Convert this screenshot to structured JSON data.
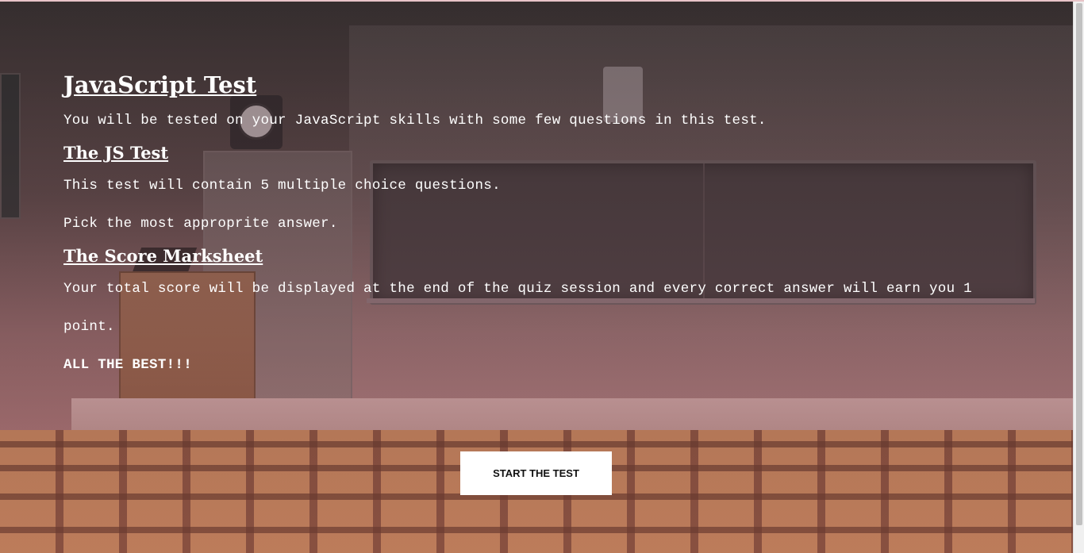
{
  "main": {
    "title": "JavaScript Test",
    "intro": "You will be tested on your JavaScript skills with some few questions in this test.",
    "sections": [
      {
        "heading": "The JS Test",
        "paragraphs": [
          "This test will contain 5 multiple choice questions.",
          "Pick the most approprite answer."
        ]
      },
      {
        "heading": "The Score Marksheet",
        "paragraphs": [
          "Your total score will be displayed at the end of the quiz session and every correct answer will earn you 1 point."
        ]
      }
    ],
    "closing": "ALL THE BEST!!!"
  },
  "actions": {
    "start_label": "START THE TEST"
  }
}
